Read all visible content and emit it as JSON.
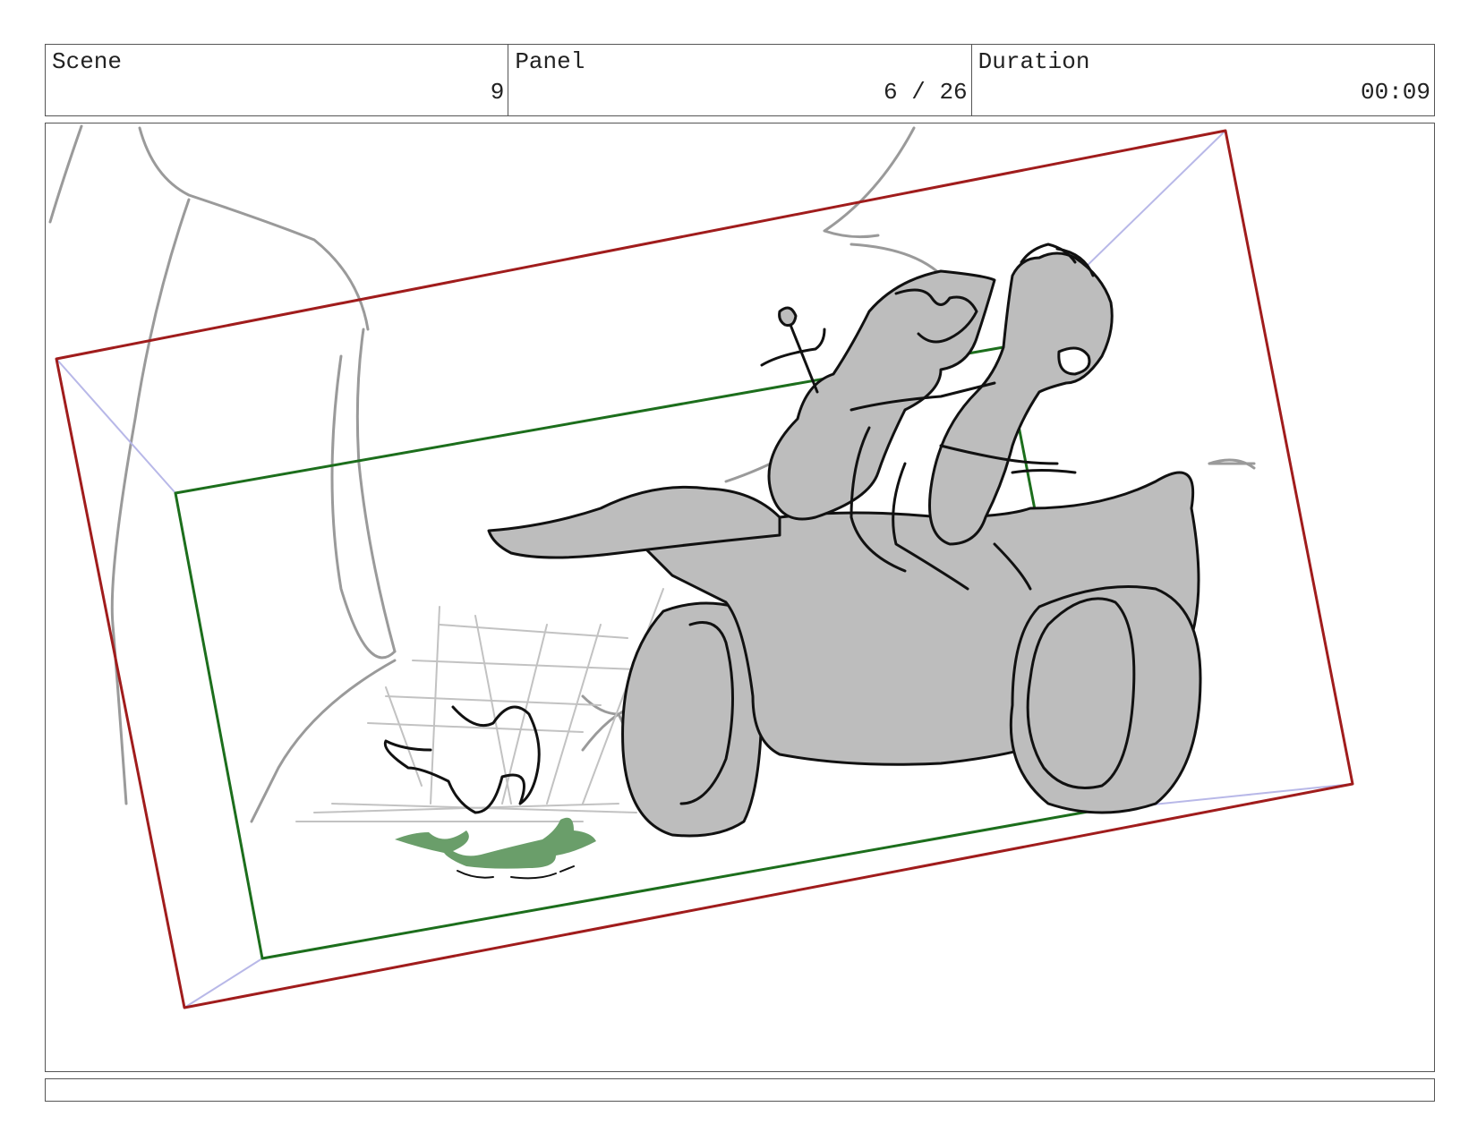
{
  "header": {
    "scene": {
      "label": "Scene",
      "value": "9"
    },
    "panel": {
      "label": "Panel",
      "value": "6 / 26"
    },
    "duration": {
      "label": "Duration",
      "value": "00:09"
    }
  },
  "drawing": {
    "subject": "rough sketch of two characters riding a motorcycle",
    "colors": {
      "outer_frame": "#a01c1c",
      "inner_frame": "#1c6e1c",
      "perspective_lines": "#b8b8e8",
      "fill": "#bdbdbd",
      "ink": "#111111",
      "background_lines": "#9a9a9a",
      "puddle": "#6a9e6a"
    }
  },
  "notes": {
    "text": ""
  }
}
